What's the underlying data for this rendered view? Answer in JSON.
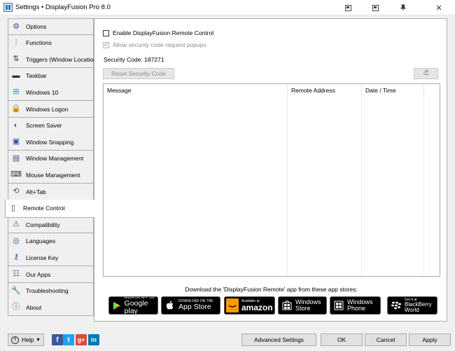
{
  "window": {
    "title": "Settings • DisplayFusion Pro 8.0",
    "close_glyph": "✕",
    "pin_glyph": "📌"
  },
  "sidebar": {
    "items": [
      {
        "label": "Options",
        "icon": "gears-icon"
      },
      {
        "label": "Functions",
        "icon": "sliders-icon"
      },
      {
        "label": "Triggers (Window Location)",
        "icon": "triggers-icon"
      },
      {
        "label": "Taskbar",
        "icon": "taskbar-icon"
      },
      {
        "label": "Windows 10",
        "icon": "windows-logo-icon"
      },
      {
        "label": "Windows Logon",
        "icon": "lock-icon"
      },
      {
        "label": "Screen Saver",
        "icon": "screen-saver-icon"
      },
      {
        "label": "Window Snapping",
        "icon": "window-snapping-icon"
      },
      {
        "label": "Window Management",
        "icon": "window-management-icon"
      },
      {
        "label": "Mouse Management",
        "icon": "mouse-icon"
      },
      {
        "label": "Alt+Tab",
        "icon": "alt-tab-icon"
      },
      {
        "label": "Remote Control",
        "icon": "remote-control-icon"
      },
      {
        "label": "Compatibility",
        "icon": "compatibility-icon"
      },
      {
        "label": "Languages",
        "icon": "languages-icon"
      },
      {
        "label": "License Key",
        "icon": "key-icon"
      },
      {
        "label": "Our Apps",
        "icon": "our-apps-icon"
      },
      {
        "label": "Troubleshooting",
        "icon": "wrench-icon"
      },
      {
        "label": "About",
        "icon": "info-icon"
      }
    ],
    "active_index": 11
  },
  "remote": {
    "enable_label": "Enable DisplayFusion Remote Control",
    "enable_checked": false,
    "popups_label": "Allow security code request popups",
    "popups_checked": true,
    "security_code_label": "Security Code: 187271",
    "reset_button": "Reset Security Code",
    "refresh_icon": "refresh-icon",
    "columns": [
      "Message",
      "Remote Address",
      "Date / Time"
    ],
    "download_text": "Download the 'DisplayFusion Remote' app from these app stores:"
  },
  "stores": [
    {
      "name": "google-play",
      "small": "ANDROID APP ON",
      "big": "Google play",
      "icon": "google-play-icon"
    },
    {
      "name": "app-store",
      "small": "Download on the",
      "big": "App Store",
      "icon": "apple-icon"
    },
    {
      "name": "amazon",
      "small": "Available at",
      "big": "amazon",
      "icon": "amazon-icon"
    },
    {
      "name": "windows-store",
      "small": "",
      "big": "Windows Store",
      "icon": "windows-store-icon"
    },
    {
      "name": "windows-phone",
      "small": "",
      "big": "Windows Phone",
      "icon": "windows-phone-icon"
    },
    {
      "name": "blackberry",
      "small": "Get it at",
      "big": "BlackBerry World",
      "icon": "blackberry-icon"
    }
  ],
  "footer": {
    "help_label": "Help",
    "advanced_label": "Advanced Settings",
    "ok_label": "OK",
    "cancel_label": "Cancel",
    "apply_label": "Apply",
    "social": [
      {
        "name": "facebook",
        "glyph": "f",
        "color": "#3b5998"
      },
      {
        "name": "twitter",
        "glyph": "t",
        "color": "#1da1f2"
      },
      {
        "name": "google-plus",
        "glyph": "g+",
        "color": "#dd4b39"
      },
      {
        "name": "linkedin",
        "glyph": "in",
        "color": "#0077b5"
      }
    ]
  }
}
